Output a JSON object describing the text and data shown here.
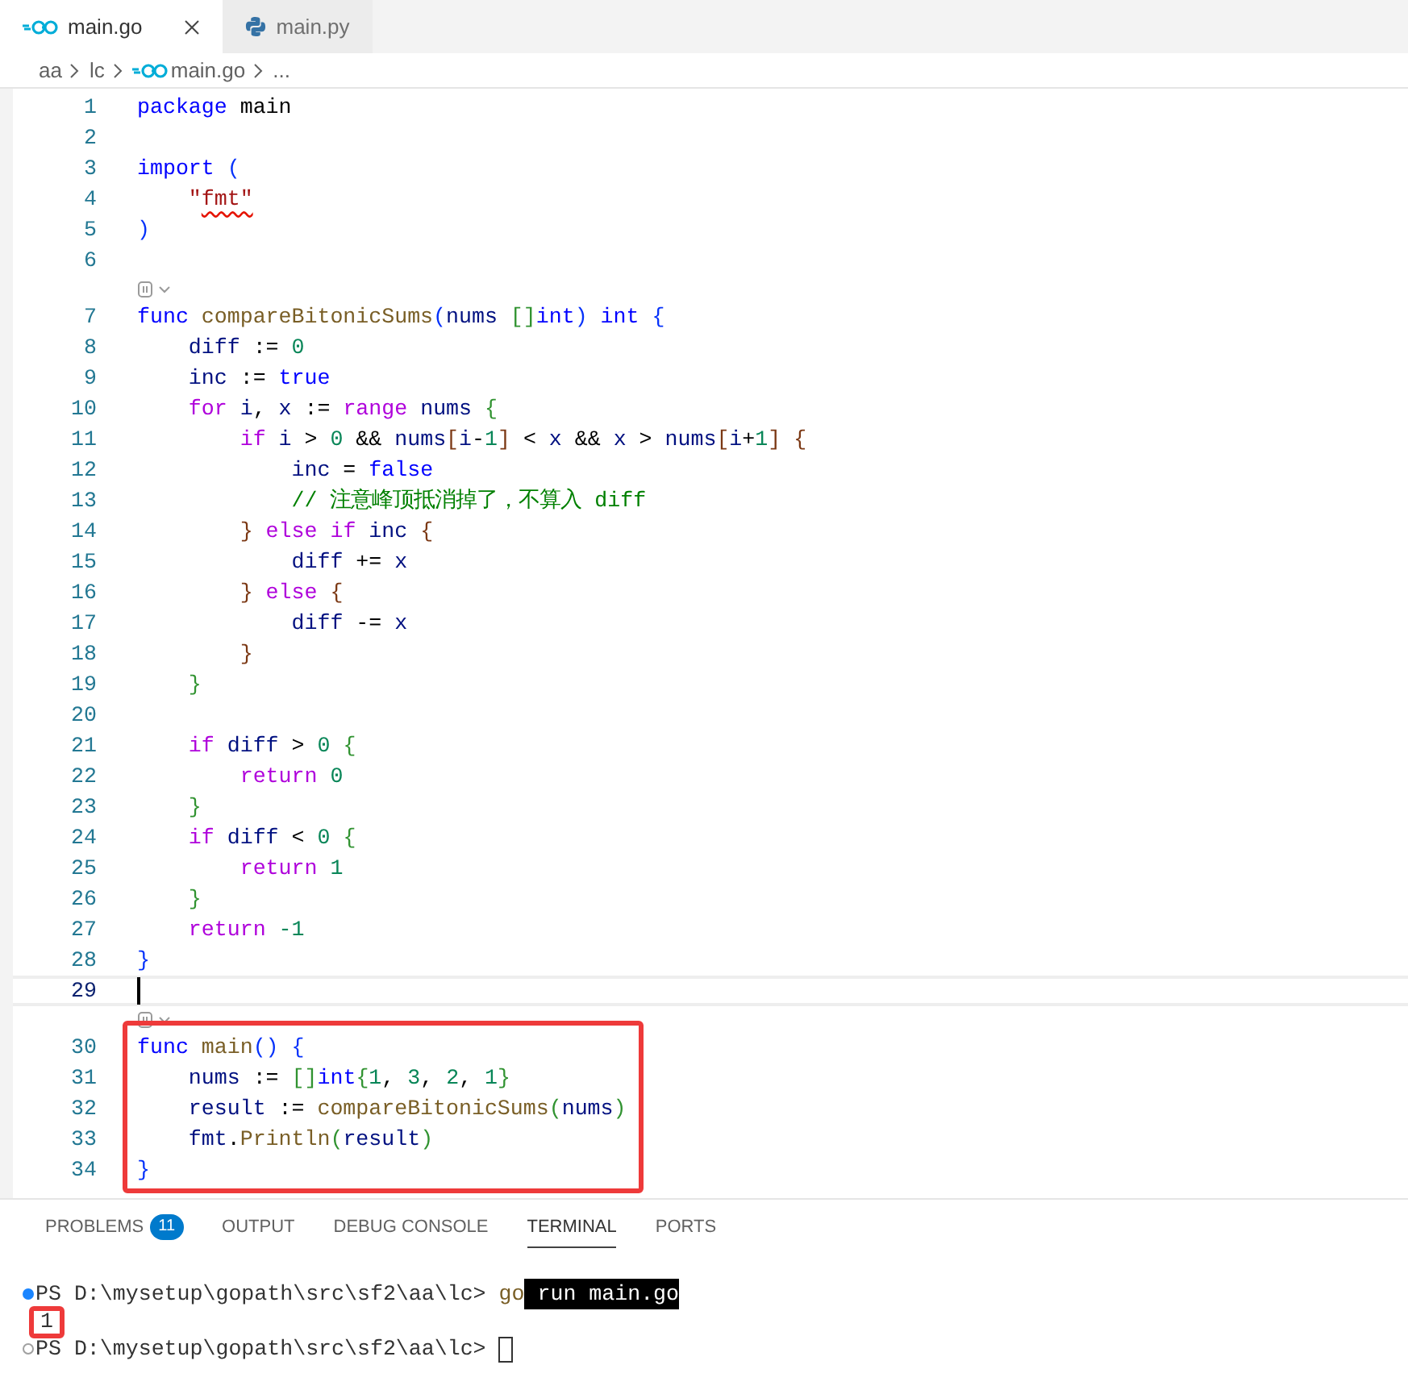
{
  "tabs": [
    {
      "label": "main.go",
      "selected": true,
      "kind": "go"
    },
    {
      "label": "main.py",
      "selected": false,
      "kind": "python"
    }
  ],
  "breadcrumb": [
    {
      "label": "aa",
      "kind": "folder"
    },
    {
      "label": "lc",
      "kind": "folder"
    },
    {
      "label": "main.go",
      "kind": "go"
    },
    {
      "label": "...",
      "kind": "symbol"
    }
  ],
  "editor": {
    "lines": [
      {
        "kind": "code",
        "number": "1",
        "tokens": [
          {
            "kind": "keyword",
            "text": "package"
          },
          {
            "kind": "plain",
            "text": " main"
          }
        ]
      },
      {
        "kind": "code",
        "number": "2"
      },
      {
        "kind": "code",
        "number": "3",
        "tokens": [
          {
            "kind": "keyword",
            "text": "import"
          },
          {
            "kind": "bracket1",
            "text": " ("
          }
        ]
      },
      {
        "kind": "code",
        "number": "4",
        "tokens": [
          {
            "kind": "string",
            "text": "    \""
          },
          {
            "kind": "string",
            "text": "fmt\"",
            "error": true
          }
        ]
      },
      {
        "kind": "code",
        "number": "5",
        "tokens": [
          {
            "kind": "bracket1",
            "text": ")"
          }
        ]
      },
      {
        "kind": "code",
        "number": "6"
      },
      {
        "kind": "codelens"
      },
      {
        "kind": "code",
        "number": "7",
        "tokens": [
          {
            "kind": "keyword",
            "text": "func"
          },
          {
            "kind": "function",
            "text": " compareBitonicSums"
          },
          {
            "kind": "bracket1",
            "text": "("
          },
          {
            "kind": "variable",
            "text": "nums"
          },
          {
            "kind": "bracket2",
            "text": " []"
          },
          {
            "kind": "keyword",
            "text": "int"
          },
          {
            "kind": "bracket1",
            "text": ")"
          },
          {
            "kind": "keyword",
            "text": " int"
          },
          {
            "kind": "bracket1",
            "text": " {"
          }
        ]
      },
      {
        "kind": "code",
        "number": "8",
        "tokens": [
          {
            "kind": "variable",
            "text": "    diff"
          },
          {
            "kind": "plain",
            "text": " := "
          },
          {
            "kind": "number",
            "text": "0"
          }
        ]
      },
      {
        "kind": "code",
        "number": "9",
        "tokens": [
          {
            "kind": "variable",
            "text": "    inc"
          },
          {
            "kind": "plain",
            "text": " := "
          },
          {
            "kind": "keyword",
            "text": "true"
          }
        ]
      },
      {
        "kind": "code",
        "number": "10",
        "tokens": [
          {
            "kind": "control",
            "text": "    for"
          },
          {
            "kind": "variable",
            "text": " i"
          },
          {
            "kind": "plain",
            "text": ", "
          },
          {
            "kind": "variable",
            "text": "x"
          },
          {
            "kind": "plain",
            "text": " := "
          },
          {
            "kind": "control",
            "text": "range"
          },
          {
            "kind": "variable",
            "text": " nums"
          },
          {
            "kind": "bracket2",
            "text": " {"
          }
        ]
      },
      {
        "kind": "code",
        "number": "11",
        "tokens": [
          {
            "kind": "control",
            "text": "        if"
          },
          {
            "kind": "variable",
            "text": " i"
          },
          {
            "kind": "plain",
            "text": " > "
          },
          {
            "kind": "number",
            "text": "0"
          },
          {
            "kind": "plain",
            "text": " && "
          },
          {
            "kind": "variable",
            "text": "nums"
          },
          {
            "kind": "bracket3",
            "text": "["
          },
          {
            "kind": "variable",
            "text": "i"
          },
          {
            "kind": "plain",
            "text": "-"
          },
          {
            "kind": "number",
            "text": "1"
          },
          {
            "kind": "bracket3",
            "text": "]"
          },
          {
            "kind": "plain",
            "text": " < "
          },
          {
            "kind": "variable",
            "text": "x"
          },
          {
            "kind": "plain",
            "text": " && "
          },
          {
            "kind": "variable",
            "text": "x"
          },
          {
            "kind": "plain",
            "text": " > "
          },
          {
            "kind": "variable",
            "text": "nums"
          },
          {
            "kind": "bracket3",
            "text": "["
          },
          {
            "kind": "variable",
            "text": "i"
          },
          {
            "kind": "plain",
            "text": "+"
          },
          {
            "kind": "number",
            "text": "1"
          },
          {
            "kind": "bracket3",
            "text": "]"
          },
          {
            "kind": "bracket3",
            "text": " {"
          }
        ]
      },
      {
        "kind": "code",
        "number": "12",
        "tokens": [
          {
            "kind": "variable",
            "text": "            inc"
          },
          {
            "kind": "plain",
            "text": " = "
          },
          {
            "kind": "keyword",
            "text": "false"
          }
        ]
      },
      {
        "kind": "code",
        "number": "13",
        "tokens": [
          {
            "kind": "comment",
            "text": "            // 注意峰顶抵消掉了，不算入 diff"
          }
        ]
      },
      {
        "kind": "code",
        "number": "14",
        "tokens": [
          {
            "kind": "bracket3",
            "text": "        }"
          },
          {
            "kind": "control",
            "text": " else"
          },
          {
            "kind": "control",
            "text": " if"
          },
          {
            "kind": "variable",
            "text": " inc"
          },
          {
            "kind": "bracket3",
            "text": " {"
          }
        ]
      },
      {
        "kind": "code",
        "number": "15",
        "tokens": [
          {
            "kind": "variable",
            "text": "            diff"
          },
          {
            "kind": "plain",
            "text": " += "
          },
          {
            "kind": "variable",
            "text": "x"
          }
        ]
      },
      {
        "kind": "code",
        "number": "16",
        "tokens": [
          {
            "kind": "bracket3",
            "text": "        }"
          },
          {
            "kind": "control",
            "text": " else"
          },
          {
            "kind": "bracket3",
            "text": " {"
          }
        ]
      },
      {
        "kind": "code",
        "number": "17",
        "tokens": [
          {
            "kind": "variable",
            "text": "            diff"
          },
          {
            "kind": "plain",
            "text": " -= "
          },
          {
            "kind": "variable",
            "text": "x"
          }
        ]
      },
      {
        "kind": "code",
        "number": "18",
        "tokens": [
          {
            "kind": "bracket3",
            "text": "        }"
          }
        ]
      },
      {
        "kind": "code",
        "number": "19",
        "tokens": [
          {
            "kind": "bracket2",
            "text": "    }"
          }
        ]
      },
      {
        "kind": "code",
        "number": "20"
      },
      {
        "kind": "code",
        "number": "21",
        "tokens": [
          {
            "kind": "control",
            "text": "    if"
          },
          {
            "kind": "variable",
            "text": " diff"
          },
          {
            "kind": "plain",
            "text": " > "
          },
          {
            "kind": "number",
            "text": "0"
          },
          {
            "kind": "bracket2",
            "text": " {"
          }
        ]
      },
      {
        "kind": "code",
        "number": "22",
        "tokens": [
          {
            "kind": "control",
            "text": "        return"
          },
          {
            "kind": "number",
            "text": " 0"
          }
        ]
      },
      {
        "kind": "code",
        "number": "23",
        "tokens": [
          {
            "kind": "bracket2",
            "text": "    }"
          }
        ]
      },
      {
        "kind": "code",
        "number": "24",
        "tokens": [
          {
            "kind": "control",
            "text": "    if"
          },
          {
            "kind": "variable",
            "text": " diff"
          },
          {
            "kind": "plain",
            "text": " < "
          },
          {
            "kind": "number",
            "text": "0"
          },
          {
            "kind": "bracket2",
            "text": " {"
          }
        ]
      },
      {
        "kind": "code",
        "number": "25",
        "tokens": [
          {
            "kind": "control",
            "text": "        return"
          },
          {
            "kind": "number",
            "text": " 1"
          }
        ]
      },
      {
        "kind": "code",
        "number": "26",
        "tokens": [
          {
            "kind": "bracket2",
            "text": "    }"
          }
        ]
      },
      {
        "kind": "code",
        "number": "27",
        "tokens": [
          {
            "kind": "control",
            "text": "    return"
          },
          {
            "kind": "number",
            "text": " -1"
          }
        ]
      },
      {
        "kind": "code",
        "number": "28",
        "tokens": [
          {
            "kind": "bracket1",
            "text": "}"
          }
        ]
      },
      {
        "kind": "code",
        "number": "29",
        "current": true
      },
      {
        "kind": "codelens"
      },
      {
        "kind": "code",
        "number": "30",
        "boxed": true,
        "tokens": [
          {
            "kind": "keyword",
            "text": "func"
          },
          {
            "kind": "function",
            "text": " main"
          },
          {
            "kind": "bracket1",
            "text": "()"
          },
          {
            "kind": "bracket1",
            "text": " {"
          }
        ]
      },
      {
        "kind": "code",
        "number": "31",
        "boxed": true,
        "tokens": [
          {
            "kind": "variable",
            "text": "    nums"
          },
          {
            "kind": "plain",
            "text": " := "
          },
          {
            "kind": "bracket2",
            "text": "[]"
          },
          {
            "kind": "keyword",
            "text": "int"
          },
          {
            "kind": "bracket2",
            "text": "{"
          },
          {
            "kind": "number",
            "text": "1"
          },
          {
            "kind": "plain",
            "text": ", "
          },
          {
            "kind": "number",
            "text": "3"
          },
          {
            "kind": "plain",
            "text": ", "
          },
          {
            "kind": "number",
            "text": "2"
          },
          {
            "kind": "plain",
            "text": ", "
          },
          {
            "kind": "number",
            "text": "1"
          },
          {
            "kind": "bracket2",
            "text": "}"
          }
        ]
      },
      {
        "kind": "code",
        "number": "32",
        "boxed": true,
        "tokens": [
          {
            "kind": "variable",
            "text": "    result"
          },
          {
            "kind": "plain",
            "text": " := "
          },
          {
            "kind": "function",
            "text": "compareBitonicSums"
          },
          {
            "kind": "bracket2",
            "text": "("
          },
          {
            "kind": "variable",
            "text": "nums"
          },
          {
            "kind": "bracket2",
            "text": ")"
          }
        ]
      },
      {
        "kind": "code",
        "number": "33",
        "boxed": true,
        "tokens": [
          {
            "kind": "variable",
            "text": "    fmt"
          },
          {
            "kind": "plain",
            "text": "."
          },
          {
            "kind": "function",
            "text": "Println"
          },
          {
            "kind": "bracket2",
            "text": "("
          },
          {
            "kind": "variable",
            "text": "result"
          },
          {
            "kind": "bracket2",
            "text": ")"
          }
        ]
      },
      {
        "kind": "code",
        "number": "34",
        "boxed": true,
        "tokens": [
          {
            "kind": "bracket1",
            "text": "}"
          }
        ]
      }
    ]
  },
  "panel": {
    "tabs": [
      {
        "label": "PROBLEMS",
        "selected": false,
        "badge": "11"
      },
      {
        "label": "OUTPUT",
        "selected": false
      },
      {
        "label": "DEBUG CONSOLE",
        "selected": false
      },
      {
        "label": "TERMINAL",
        "selected": true
      },
      {
        "label": "PORTS",
        "selected": false
      }
    ],
    "terminal": [
      {
        "kind": "prompt",
        "done": true,
        "prompt": "PS D:\\mysetup\\gopath\\src\\sf2\\aa\\lc>",
        "command": "go",
        "selection": " run main.go"
      },
      {
        "kind": "output",
        "text": "1",
        "boxed": true
      },
      {
        "kind": "prompt",
        "done": false,
        "prompt": "PS D:\\mysetup\\gopath\\src\\sf2\\aa\\lc>",
        "cursor": true
      }
    ]
  }
}
